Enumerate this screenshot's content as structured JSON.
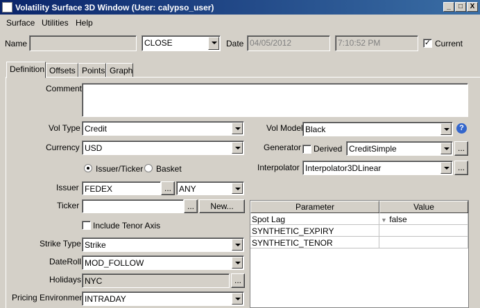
{
  "window": {
    "title": "Volatility Surface 3D Window (User: calypso_user)",
    "controls": [
      "_",
      "□",
      "X"
    ]
  },
  "menu": [
    "Surface",
    "Utilities",
    "Help"
  ],
  "header": {
    "name_label": "Name",
    "name_value": "",
    "type_value": "CLOSE",
    "date_label": "Date",
    "date_value": "04/05/2012",
    "time_value": "7:10:52 PM",
    "current_label": "Current",
    "current_checked": "✓"
  },
  "tabs": [
    "Definition",
    "Offsets",
    "Points",
    "Graph"
  ],
  "form": {
    "comment_label": "Comment",
    "comment_value": "",
    "vol_type_label": "Vol Type",
    "vol_type_value": "Credit",
    "currency_label": "Currency",
    "currency_value": "USD",
    "issuer_ticker_label": "Issuer/Ticker",
    "basket_label": "Basket",
    "issuer_label": "Issuer",
    "issuer_value": "FEDEX",
    "issuer_btn": "...",
    "issuer_any": "ANY",
    "ticker_label": "Ticker",
    "ticker_value": "",
    "ticker_btn": "...",
    "new_btn": "New...",
    "include_tenor_label": "Include Tenor Axis",
    "strike_type_label": "Strike Type",
    "strike_type_value": "Strike",
    "dateroll_label": "DateRoll",
    "dateroll_value": "MOD_FOLLOW",
    "holidays_label": "Holidays",
    "holidays_value": "NYC",
    "holidays_btn": "...",
    "pricing_env_label": "Pricing Environment",
    "pricing_env_value": "INTRADAY",
    "vol_model_label": "Vol Model",
    "vol_model_value": "Black",
    "help_icon": "?",
    "generator_label": "Generator",
    "derived_label": "Derived",
    "generator_value": "CreditSimple",
    "generator_btn": "...",
    "interpolator_label": "Interpolator",
    "interpolator_value": "Interpolator3DLinear",
    "interpolator_btn": "..."
  },
  "params": {
    "col_parameter": "Parameter",
    "col_value": "Value",
    "rows": [
      {
        "name": "Spot Lag",
        "value": "false"
      },
      {
        "name": "SYNTHETIC_EXPIRY",
        "value": ""
      },
      {
        "name": "SYNTHETIC_TENOR",
        "value": ""
      }
    ]
  }
}
